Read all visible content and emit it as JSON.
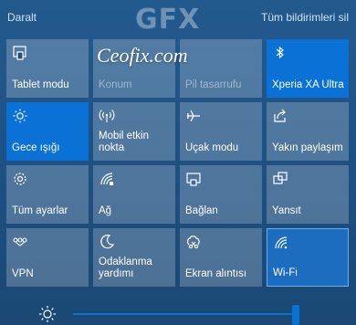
{
  "header": {
    "collapse_label": "Daralt",
    "clear_all_label": "Tüm bildirimleri sil"
  },
  "watermark": {
    "logo_text": "GFX",
    "site_text": "Ceofix.com"
  },
  "tiles": [
    {
      "label": "Tablet modu",
      "icon": "tablet-icon",
      "state": "off"
    },
    {
      "label": "Konum",
      "icon": "location-icon",
      "state": "disabled"
    },
    {
      "label": "Pil tasarrufu",
      "icon": "battery-saver-icon",
      "state": "disabled"
    },
    {
      "label": "Xperia XA Ultra",
      "icon": "bluetooth-icon",
      "state": "on"
    },
    {
      "label": "Gece ışığı",
      "icon": "night-light-icon",
      "state": "on"
    },
    {
      "label": "Mobil etkin nokta",
      "icon": "mobile-hotspot-icon",
      "state": "off"
    },
    {
      "label": "Uçak modu",
      "icon": "airplane-icon",
      "state": "off"
    },
    {
      "label": "Yakın paylaşım",
      "icon": "nearby-share-icon",
      "state": "off"
    },
    {
      "label": "Tüm ayarlar",
      "icon": "gear-icon",
      "state": "off"
    },
    {
      "label": "Ağ",
      "icon": "network-icon",
      "state": "off"
    },
    {
      "label": "Bağlan",
      "icon": "connect-icon",
      "state": "off"
    },
    {
      "label": "Yansıt",
      "icon": "project-icon",
      "state": "off"
    },
    {
      "label": "VPN",
      "icon": "vpn-icon",
      "state": "off"
    },
    {
      "label": "Odaklanma yardımı",
      "icon": "focus-assist-icon",
      "state": "off"
    },
    {
      "label": "Ekran alıntısı",
      "icon": "screen-snip-icon",
      "state": "off"
    },
    {
      "label": "Wi-Fi",
      "icon": "wifi-icon",
      "state": "selected"
    }
  ],
  "brightness": {
    "icon": "brightness-icon",
    "level": 0.98,
    "accent": "#0a72d6"
  },
  "colors": {
    "tile_on": "#0a72d6",
    "panel": "#235a8e"
  }
}
